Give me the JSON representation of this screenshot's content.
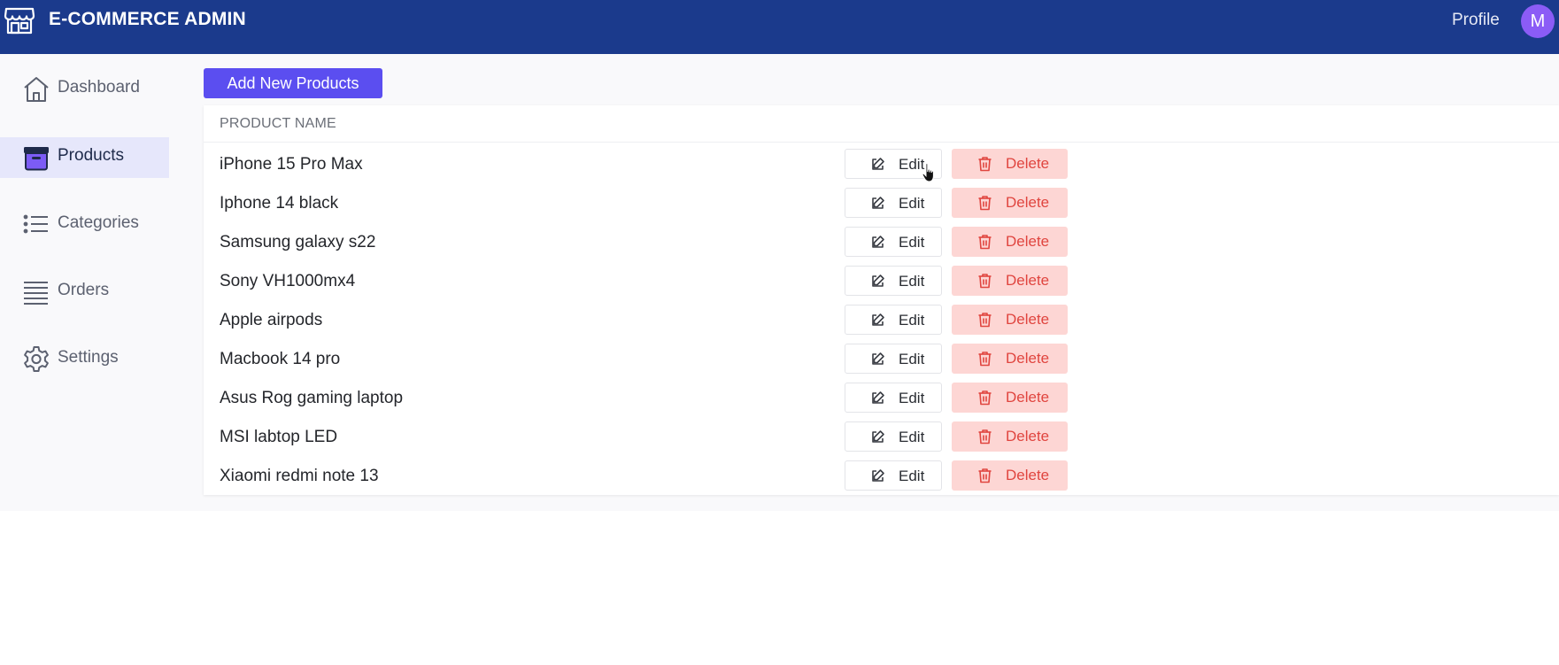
{
  "header": {
    "title": "E-COMMERCE ADMIN",
    "brand_icon": "store-icon",
    "profile_label": "Profile",
    "avatar_initial": "M",
    "background_color": "#1b3a8c",
    "avatar_color": "#8b5cf6"
  },
  "sidebar": {
    "items": [
      {
        "label": "Dashboard",
        "icon": "home-icon",
        "active": false
      },
      {
        "label": "Products",
        "icon": "archive-box-icon",
        "active": true
      },
      {
        "label": "Categories",
        "icon": "list-icon",
        "active": false
      },
      {
        "label": "Orders",
        "icon": "stacked-lines-icon",
        "active": false
      },
      {
        "label": "Settings",
        "icon": "gear-icon",
        "active": false
      }
    ]
  },
  "main": {
    "add_button_label": "Add New Products",
    "accent_color": "#5b4ef0",
    "table": {
      "columns": [
        "PRODUCT NAME"
      ],
      "edit_label": "Edit",
      "delete_label": "Delete",
      "delete_color": "#e0453f",
      "rows": [
        {
          "name": "iPhone 15 Pro Max"
        },
        {
          "name": "Iphone 14 black"
        },
        {
          "name": "Samsung galaxy s22"
        },
        {
          "name": "Sony VH1000mx4"
        },
        {
          "name": "Apple airpods"
        },
        {
          "name": "Macbook 14 pro"
        },
        {
          "name": "Asus Rog gaming laptop"
        },
        {
          "name": "MSI labtop LED"
        },
        {
          "name": "Xiaomi redmi note 13"
        }
      ]
    }
  }
}
